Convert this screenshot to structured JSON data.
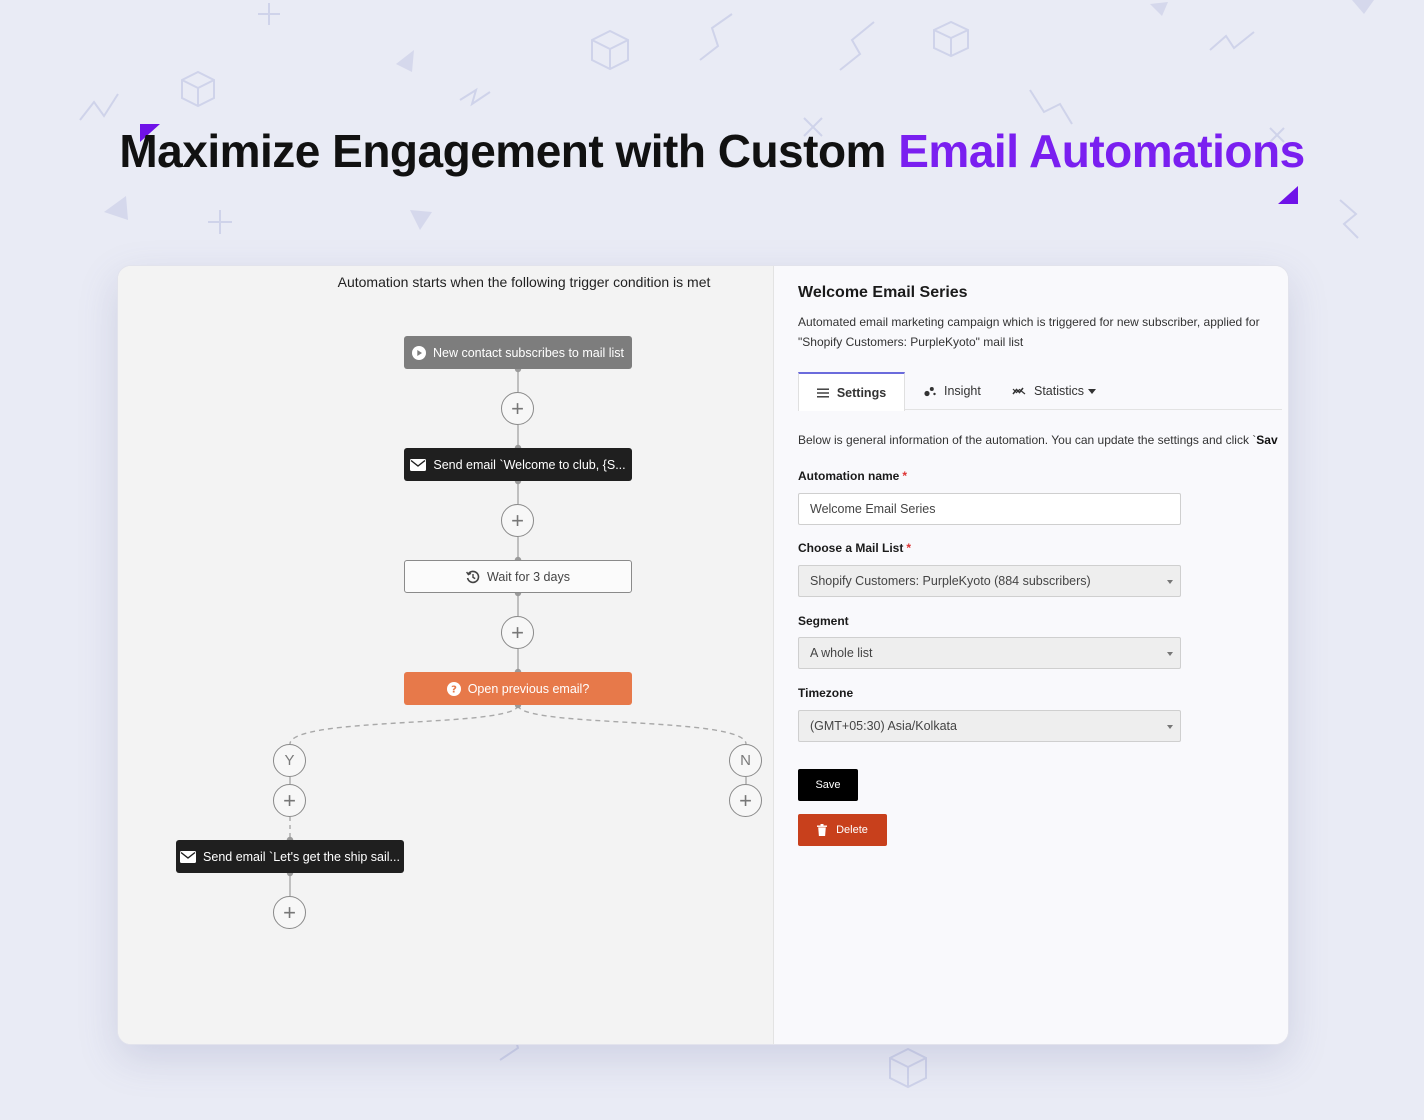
{
  "headline": {
    "lead": "Maximize Engagement with Custom",
    "accent": "Email Automations",
    "accent_color": "#7a1ff0"
  },
  "flow": {
    "trigger_caption": "Automation starts when the following trigger condition is met",
    "trigger_node": "New contact subscribes to mail list",
    "email_node_1": "Send email `Welcome to club, {S...",
    "wait_node": "Wait for 3 days",
    "condition_node": "Open previous email?",
    "branch_yes": "Y",
    "branch_no": "N",
    "email_node_2": "Send email `Let's get the ship sail...",
    "add_symbol": "+",
    "condition_color": "#e7794a"
  },
  "panel": {
    "title": "Welcome Email Series",
    "description": "Automated email marketing campaign which is triggered for new subscriber, applied for \"Shopify Customers: PurpleKyoto\" mail list",
    "tabs": {
      "settings": "Settings",
      "insight": "Insight",
      "statistics": "Statistics"
    },
    "info_text": "Below is general information of the automation. You can update the settings and click `",
    "info_bold": "Sav",
    "fields": {
      "name_label": "Automation name",
      "name_value": "Welcome Email Series",
      "list_label": "Choose a Mail List",
      "list_value": "Shopify Customers: PurpleKyoto (884 subscribers)",
      "segment_label": "Segment",
      "segment_value": "A whole list",
      "timezone_label": "Timezone",
      "timezone_value": "(GMT+05:30) Asia/Kolkata",
      "required_mark": "*"
    },
    "save_label": "Save",
    "delete_label": "Delete",
    "delete_color": "#c8401c"
  }
}
